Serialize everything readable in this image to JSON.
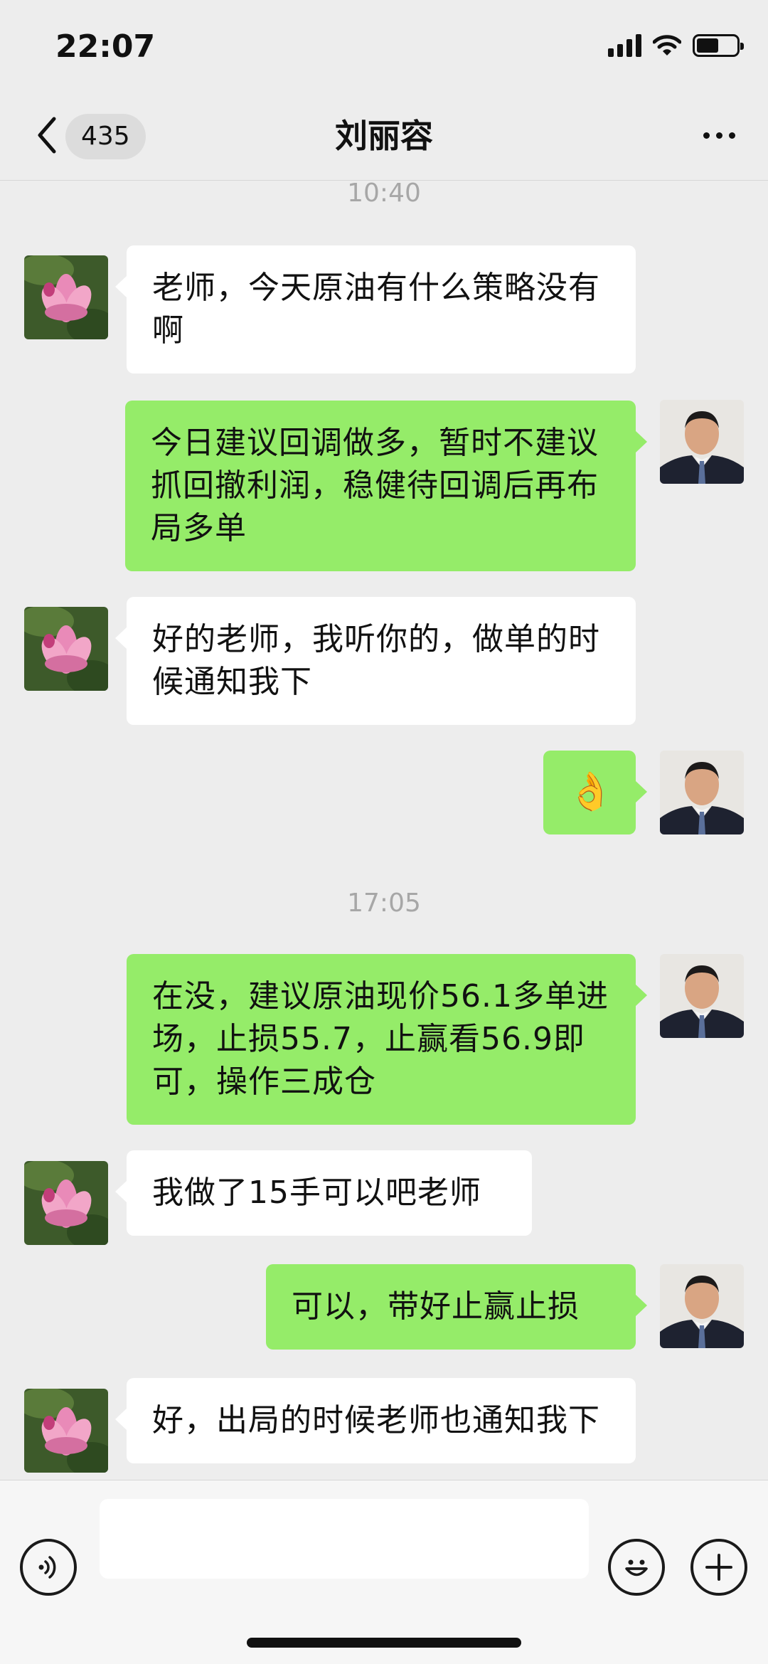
{
  "status_bar": {
    "time": "22:07",
    "battery_level": 0.55
  },
  "header": {
    "back_label": "back",
    "unread_count": "435",
    "title": "刘丽容"
  },
  "messages": [
    {
      "type": "time",
      "text": "10:40"
    },
    {
      "type": "in",
      "text": "老师，今天原油有什么策略没有啊"
    },
    {
      "type": "out",
      "text": "今日建议回调做多，暂时不建议抓回撤利润，稳健待回调后再布局多单"
    },
    {
      "type": "in",
      "text": "好的老师，我听你的，做单的时候通知我下"
    },
    {
      "type": "out",
      "text": "👌"
    },
    {
      "type": "time",
      "text": "17:05"
    },
    {
      "type": "out",
      "text": "在没，建议原油现价56.1多单进场，止损55.7，止赢看56.9即可，操作三成仓"
    },
    {
      "type": "in",
      "text": "我做了15手可以吧老师"
    },
    {
      "type": "out",
      "text": "可以，带好止赢止损"
    },
    {
      "type": "in",
      "text": "好，出局的时候老师也通知我下"
    }
  ],
  "input": {
    "placeholder": ""
  },
  "colors": {
    "background": "#ededed",
    "incoming_bubble": "#ffffff",
    "outgoing_bubble": "#95ec69"
  },
  "icons": [
    "chevron-left-icon",
    "more-dots-icon",
    "voice-icon",
    "emoji-icon",
    "plus-icon"
  ]
}
